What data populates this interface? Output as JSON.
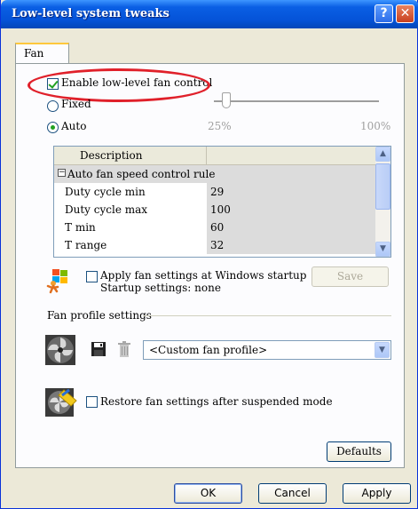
{
  "window": {
    "title": "Low-level system tweaks",
    "help_glyph": "?",
    "close_glyph": "✕"
  },
  "tabs": [
    {
      "label": "Fan"
    }
  ],
  "fan": {
    "enable_label": "Enable low-level fan control",
    "enable_checked": true,
    "fixed_label": "Fixed",
    "auto_label": "Auto",
    "selected_mode": "Auto",
    "slider_min": "25%",
    "slider_max": "100%"
  },
  "table": {
    "header": "Description",
    "group": "Auto fan speed control rule",
    "group_toggle": "−",
    "rows": [
      {
        "name": "Duty cycle min",
        "value": "29"
      },
      {
        "name": "Duty cycle max",
        "value": "100"
      },
      {
        "name": "T min",
        "value": "60"
      },
      {
        "name": "T range",
        "value": "32"
      }
    ],
    "scroll_up": "▲",
    "scroll_down": "▼"
  },
  "startup": {
    "apply_label": "Apply fan settings at Windows startup",
    "startup_settings": "Startup settings:  none",
    "save_label": "Save"
  },
  "profile": {
    "group_label": "Fan profile settings",
    "selected": "<Custom fan profile>",
    "dropdown_glyph": "▼"
  },
  "restore_label": "Restore fan settings after suspended mode",
  "buttons": {
    "defaults": "Defaults",
    "ok": "OK",
    "cancel": "Cancel",
    "apply": "Apply"
  },
  "colors": {
    "titlebar": "#0553d8",
    "highlight_ellipse": "#e0202a",
    "check": "#21a121"
  }
}
